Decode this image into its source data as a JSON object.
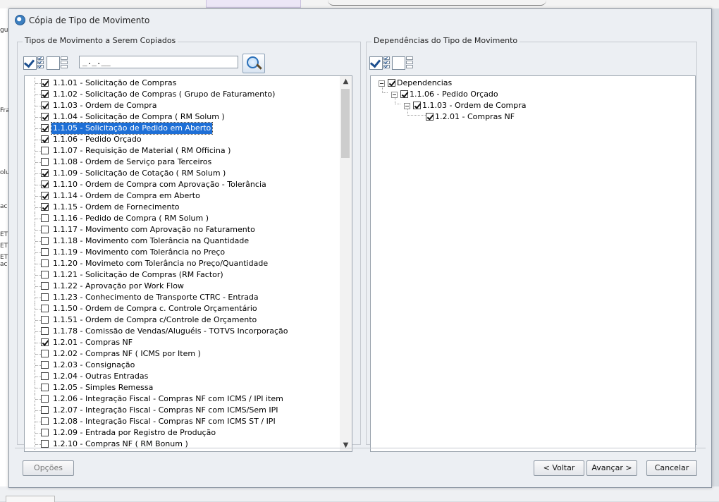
{
  "background": {
    "left_fragments": [
      "gu",
      "Fra",
      "olu",
      "ac",
      "ET",
      "ET",
      "ET",
      "ac"
    ]
  },
  "dialog": {
    "title": "Cópia de Tipo de Movimento",
    "left_group_title": "Tipos de Movimento a Serem Copiados",
    "right_group_title": "Dependências do Tipo de Movimento",
    "filter_value": "_._.__",
    "items": [
      {
        "label": "1.1.01 - Solicitação de Compras",
        "checked": true
      },
      {
        "label": "1.1.02 - Solicitação de Compras ( Grupo de Faturamento)",
        "checked": true
      },
      {
        "label": "1.1.03 - Ordem de Compra",
        "checked": true
      },
      {
        "label": "1.1.04 - Solicitação de Compra  ( RM Solum )",
        "checked": true
      },
      {
        "label": "1.1.05 - Solicitação de Pedido em Aberto",
        "checked": true,
        "selected": true
      },
      {
        "label": "1.1.06 - Pedido Orçado",
        "checked": true
      },
      {
        "label": "1.1.07 - Requisição de Material ( RM Officina )",
        "checked": false
      },
      {
        "label": "1.1.08 - Ordem de Serviço para Terceiros",
        "checked": false
      },
      {
        "label": "1.1.09 - Solicitação de Cotação  ( RM Solum )",
        "checked": true
      },
      {
        "label": "1.1.10 - Ordem de Compra com Aprovação - Tolerância",
        "checked": true
      },
      {
        "label": "1.1.14 - Ordem de Compra em Aberto",
        "checked": true
      },
      {
        "label": "1.1.15 - Ordem de Fornecimento",
        "checked": true
      },
      {
        "label": "1.1.16 - Pedido de Compra  ( RM Solum )",
        "checked": false
      },
      {
        "label": "1.1.17 - Movimento com Aprovação no Faturamento",
        "checked": false
      },
      {
        "label": "1.1.18 - Movimento com Tolerância na Quantidade",
        "checked": false
      },
      {
        "label": "1.1.19 - Movimento com Tolerância no Preço",
        "checked": false
      },
      {
        "label": "1.1.20 - Movimeto com Tolerância no Preço/Quantidade",
        "checked": false
      },
      {
        "label": "1.1.21 - Solicitação de Compras (RM Factor)",
        "checked": false
      },
      {
        "label": "1.1.22 - Aprovação por Work Flow",
        "checked": false
      },
      {
        "label": "1.1.23 - Conhecimento de Transporte CTRC - Entrada",
        "checked": false
      },
      {
        "label": "1.1.50 - Ordem de Compra c. Controle Orçamentário",
        "checked": false
      },
      {
        "label": "1.1.51 - Ordem de Compra c/Controle de Orçamento",
        "checked": false
      },
      {
        "label": "1.1.78 - Comissão de Vendas/Aluguéis - TOTVS Incorporação",
        "checked": false
      },
      {
        "label": "1.2.01 - Compras NF",
        "checked": true
      },
      {
        "label": "1.2.02 - Compras NF ( ICMS por Item )",
        "checked": false
      },
      {
        "label": "1.2.03 - Consignação",
        "checked": false
      },
      {
        "label": "1.2.04 - Outras Entradas",
        "checked": false
      },
      {
        "label": "1.2.05 - Simples Remessa",
        "checked": false
      },
      {
        "label": "1.2.06 - Integração Fiscal - Compras NF com ICMS / IPI item",
        "checked": false
      },
      {
        "label": "1.2.07 - Integração Fiscal - Compras NF com ICMS/Sem IPI",
        "checked": false
      },
      {
        "label": "1.2.08 - Integração Fiscal - Compras NF com ICMS ST / IPI",
        "checked": false
      },
      {
        "label": "1.2.09 - Entrada por Registro de Produção",
        "checked": false
      },
      {
        "label": "1.2.10 - Compras NF  ( RM Bonum )",
        "checked": false
      }
    ],
    "dependencies": {
      "root": "Dependencias",
      "level1": "1.1.06 - Pedido Orçado",
      "level2": "1.1.03 - Ordem de Compra",
      "level3": "1.2.01 - Compras NF"
    },
    "buttons": {
      "options": "Opções",
      "back": "< Voltar",
      "next": "Avançar >",
      "cancel": "Cancelar"
    }
  }
}
